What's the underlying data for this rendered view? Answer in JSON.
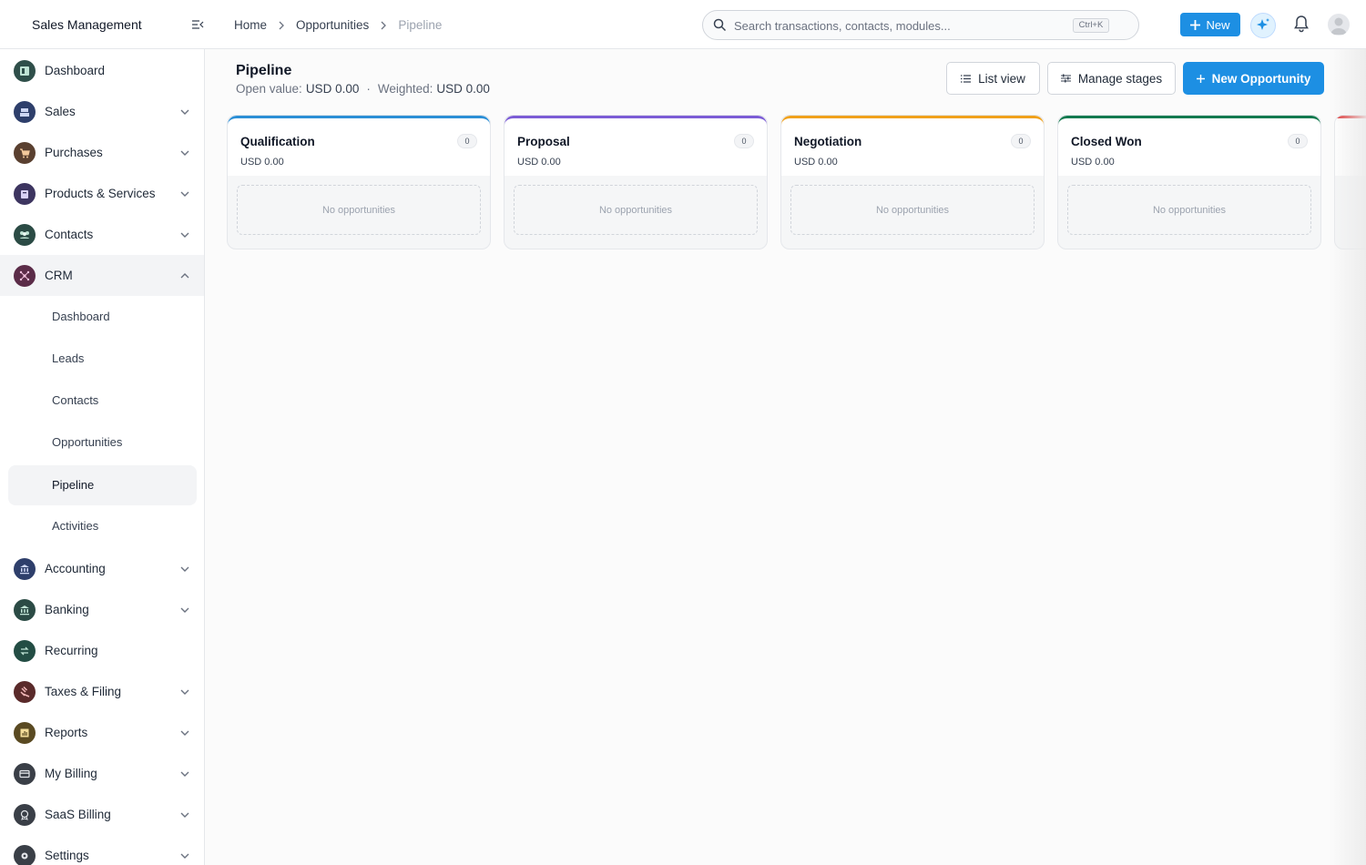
{
  "app": {
    "title": "Sales Management"
  },
  "breadcrumb": {
    "home": "Home",
    "opportunities": "Opportunities",
    "current": "Pipeline"
  },
  "search": {
    "placeholder": "Search transactions, contacts, modules...",
    "shortcut": "Ctrl+K"
  },
  "header": {
    "new_label": "New"
  },
  "sidebar": {
    "items": [
      {
        "label": "Dashboard"
      },
      {
        "label": "Sales"
      },
      {
        "label": "Purchases"
      },
      {
        "label": "Products & Services"
      },
      {
        "label": "Contacts"
      },
      {
        "label": "CRM"
      },
      {
        "label": "Accounting"
      },
      {
        "label": "Banking"
      },
      {
        "label": "Recurring"
      },
      {
        "label": "Taxes & Filing"
      },
      {
        "label": "Reports"
      },
      {
        "label": "My Billing"
      },
      {
        "label": "SaaS Billing"
      },
      {
        "label": "Settings"
      }
    ],
    "crm_sub": [
      {
        "label": "Dashboard"
      },
      {
        "label": "Leads"
      },
      {
        "label": "Contacts"
      },
      {
        "label": "Opportunities"
      },
      {
        "label": "Pipeline"
      },
      {
        "label": "Activities"
      }
    ]
  },
  "page": {
    "title": "Pipeline",
    "open_value_label": "Open value:",
    "open_value": "USD 0.00",
    "separator": "·",
    "weighted_label": "Weighted:",
    "weighted_value": "USD 0.00",
    "list_view_label": "List view",
    "manage_stages_label": "Manage stages",
    "new_opportunity_label": "New Opportunity"
  },
  "stages": [
    {
      "name": "Qualification",
      "amount": "USD 0.00",
      "count": "0",
      "empty": "No opportunities",
      "color": "#2b8fd6"
    },
    {
      "name": "Proposal",
      "amount": "USD 0.00",
      "count": "0",
      "empty": "No opportunities",
      "color": "#7c5cd6"
    },
    {
      "name": "Negotiation",
      "amount": "USD 0.00",
      "count": "0",
      "empty": "No opportunities",
      "color": "#f0a11c"
    },
    {
      "name": "Closed Won",
      "amount": "USD 0.00",
      "count": "0",
      "empty": "No opportunities",
      "color": "#137a4f"
    }
  ],
  "colors": {
    "accent": "#1d8fe3"
  }
}
